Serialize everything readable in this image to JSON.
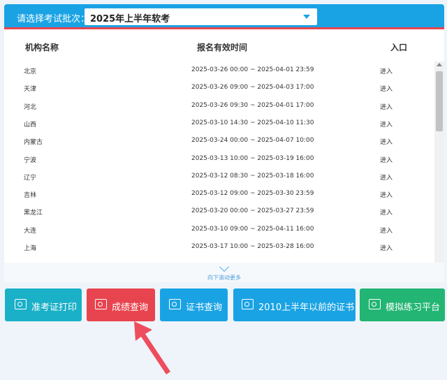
{
  "header": {
    "label": "请选择考试批次：",
    "selected_batch": "2025年上半年软考"
  },
  "table": {
    "columns": [
      "机构名称",
      "报名有效时间",
      "入口"
    ],
    "rows": [
      {
        "name": "北京",
        "time": "2025-03-26 00:00 ~ 2025-04-01 23:59",
        "enter": "进入"
      },
      {
        "name": "天津",
        "time": "2025-03-26 09:00 ~ 2025-04-03 17:00",
        "enter": "进入"
      },
      {
        "name": "河北",
        "time": "2025-03-26 09:30 ~ 2025-04-01 17:00",
        "enter": "进入"
      },
      {
        "name": "山西",
        "time": "2025-03-10 14:30 ~ 2025-04-10 11:30",
        "enter": "进入"
      },
      {
        "name": "内蒙古",
        "time": "2025-03-24 00:00 ~ 2025-04-07 10:00",
        "enter": "进入"
      },
      {
        "name": "宁波",
        "time": "2025-03-13 10:00 ~ 2025-03-19 16:00",
        "enter": "进入"
      },
      {
        "name": "辽宁",
        "time": "2025-03-12 08:30 ~ 2025-03-18 16:00",
        "enter": "进入"
      },
      {
        "name": "吉林",
        "time": "2025-03-12 09:00 ~ 2025-03-30 23:59",
        "enter": "进入"
      },
      {
        "name": "黑龙江",
        "time": "2025-03-20 00:00 ~ 2025-03-27 23:59",
        "enter": "进入"
      },
      {
        "name": "大连",
        "time": "2025-03-10 09:00 ~ 2025-04-11 16:00",
        "enter": "进入"
      },
      {
        "name": "上海",
        "time": "2025-03-17 10:00 ~ 2025-03-28 16:00",
        "enter": "进入"
      }
    ]
  },
  "scroll_hint": "向下滚动更多",
  "buttons": [
    {
      "label": "准考证打印",
      "color": "#1ab0c8"
    },
    {
      "label": "成绩查询",
      "color": "#e8444f"
    },
    {
      "label": "证书查询",
      "color": "#1aa3e4"
    },
    {
      "label": "2010上半年以前的证书",
      "color": "#1aa3e4"
    },
    {
      "label": "模拟练习平台",
      "color": "#22b573"
    }
  ],
  "colors": {
    "accent": "#1aa3e4",
    "highlight_arrow": "#ee4d5e"
  }
}
